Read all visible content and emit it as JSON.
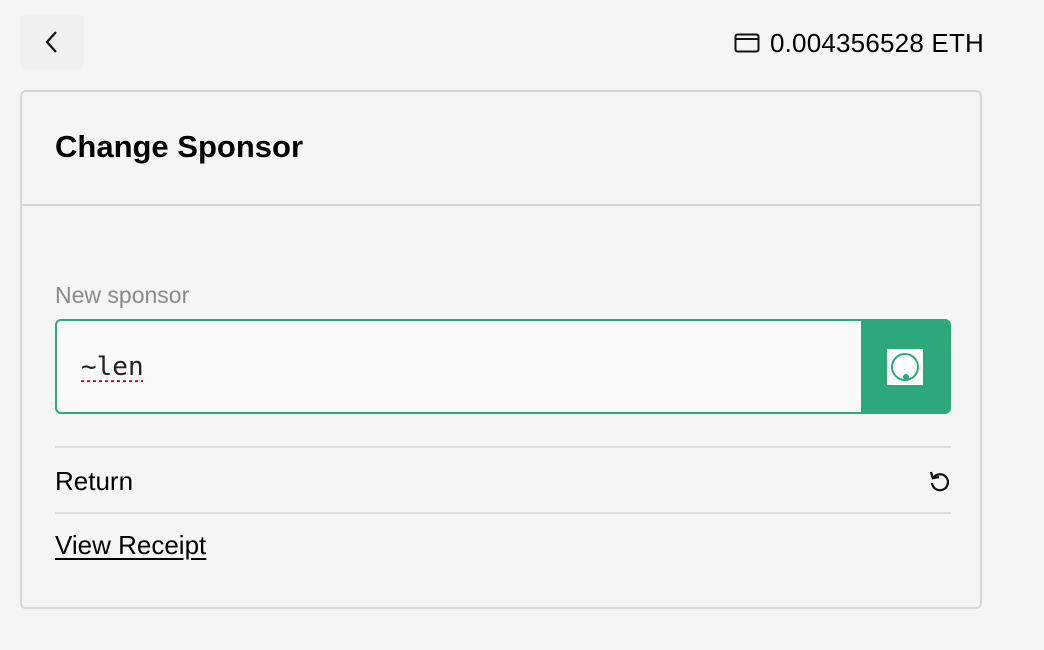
{
  "header": {
    "back_icon": "chevron-left-icon",
    "wallet_icon": "wallet-icon",
    "balance": "0.004356528 ETH"
  },
  "card": {
    "title": "Change Sponsor",
    "field_label": "New sponsor",
    "input_value": "~len",
    "scan_icon": "sigil-scan-icon",
    "return_label": "Return",
    "return_icon": "undo-icon",
    "receipt_link": "View Receipt"
  },
  "colors": {
    "accent": "#2ca87a",
    "background": "#f5f5f5",
    "border": "#d6d6d6",
    "label": "#8a8a8a"
  }
}
